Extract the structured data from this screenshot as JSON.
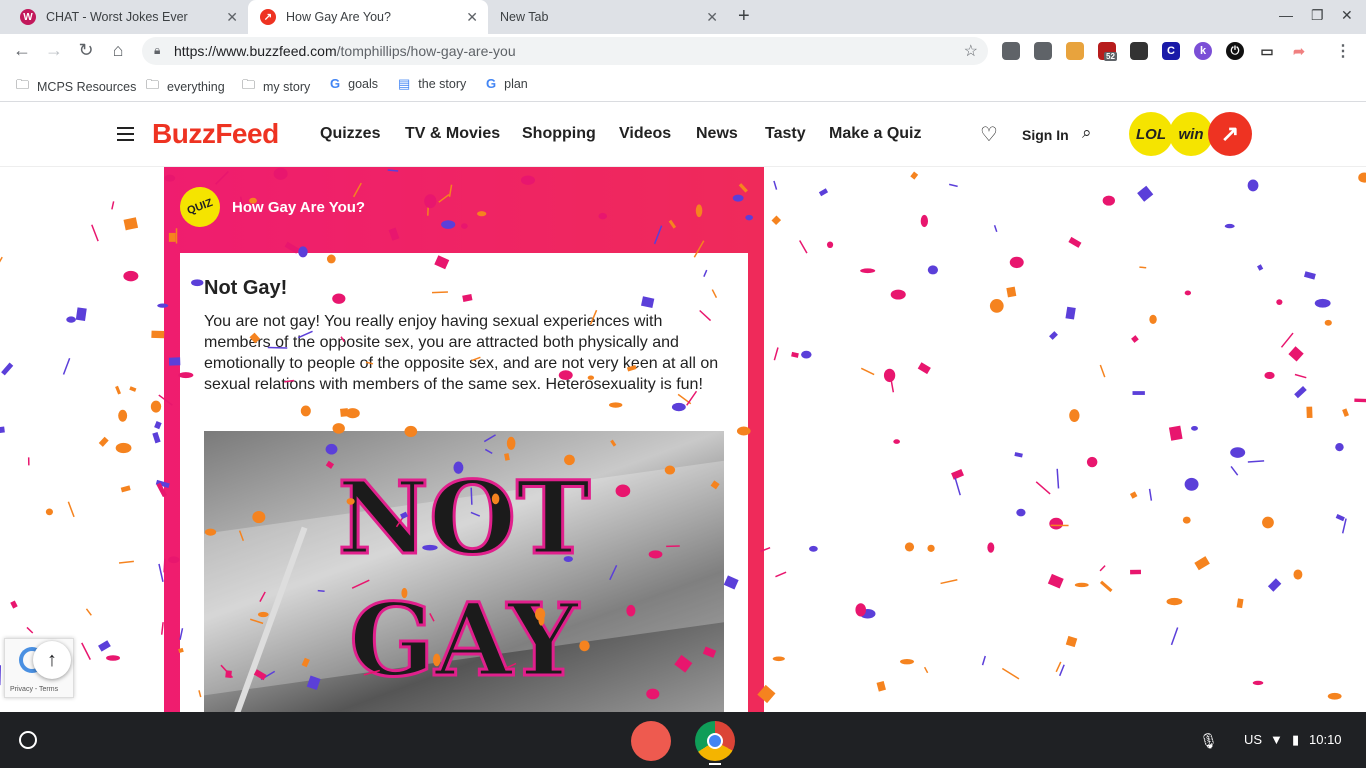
{
  "browser": {
    "tabs": [
      {
        "title": "CHAT - Worst Jokes Ever",
        "icon": "W",
        "icon_color": "#c2185b",
        "active": false
      },
      {
        "title": "How Gay Are You?",
        "icon": "↗",
        "icon_color": "#ee3322",
        "active": true
      },
      {
        "title": "New Tab",
        "icon": "",
        "icon_color": "",
        "active": false
      }
    ],
    "new_tab_label": "+",
    "url_host": "https://www.buzzfeed.com",
    "url_path": "/tomphillips/how-gay-are-you",
    "extension_badge_count": "52",
    "bookmarks": [
      {
        "label": "MCPS Resources",
        "icon": "folder-icon"
      },
      {
        "label": "everything",
        "icon": "folder-icon"
      },
      {
        "label": "my story",
        "icon": "folder-icon"
      },
      {
        "label": "goals",
        "icon": "google-icon"
      },
      {
        "label": "the story",
        "icon": "docs-icon"
      },
      {
        "label": "plan",
        "icon": "google-icon"
      }
    ]
  },
  "site": {
    "logo": "BuzzFeed",
    "nav": [
      "Quizzes",
      "TV & Movies",
      "Shopping",
      "Videos",
      "News",
      "Tasty",
      "Make a Quiz"
    ],
    "sign_in": "Sign In",
    "badges": [
      "LOL",
      "win",
      "↗"
    ]
  },
  "quiz": {
    "badge": "QUIZ",
    "title": "How Gay Are You?",
    "result_title": "Not Gay!",
    "result_description": "You are not gay! You really enjoy having sexual experiences with members of the opposite sex, you are attracted both physically and emotionally to people of the opposite sex, and are not very keen at all on sexual relations with members of the same sex. Heterosexuality is fun!",
    "image_text_line1": "NOT",
    "image_text_line2": "GAY"
  },
  "recaptcha": {
    "text": "Privacy - Terms"
  },
  "scroll_top_label": "↑",
  "shelf": {
    "input_method": "US",
    "clock": "10:10"
  },
  "colors": {
    "brand_red": "#ee3322",
    "quiz_pink": "#ef1d6f",
    "lol_yellow": "#f5e400",
    "trending_red": "#ee3322",
    "confetti": [
      "#f5831f",
      "#5b3fd9",
      "#e8166e"
    ]
  }
}
